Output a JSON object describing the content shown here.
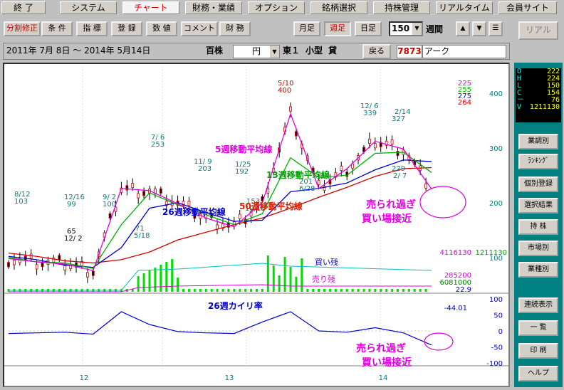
{
  "menu_tabs": [
    {
      "label": "終 了",
      "active": false
    },
    {
      "label": "システム",
      "active": false
    },
    {
      "label": "チャート",
      "active": true
    },
    {
      "label": "財務・業績",
      "active": false
    },
    {
      "label": "オプション",
      "active": false
    },
    {
      "label": "銘柄選択",
      "active": false
    },
    {
      "label": "持株管理",
      "active": false
    },
    {
      "label": "リアルタイム",
      "active": false
    },
    {
      "label": "会員サイト",
      "active": false
    }
  ],
  "toolbar": {
    "left_buttons": [
      "分割修正",
      "条 件",
      "指 標",
      "登 録",
      "数 値",
      "コメント",
      "財 務"
    ],
    "period_buttons": [
      "月足",
      "週足",
      "日足"
    ],
    "period_active": "週足",
    "count_value": "150",
    "count_unit": "週間",
    "nav_up": "▲",
    "nav_down": "▼",
    "nav_menu": "☰",
    "realtime_button": "リアル"
  },
  "info_bar": {
    "date_range": "2011年 7月 8日 ～ 2014年 5月14日",
    "unit": "百株",
    "currency": "円",
    "market": "東１",
    "size": "小型",
    "lending": "貸",
    "back_button": "戻る",
    "code": "7873",
    "name": "アーク"
  },
  "ohlc": {
    "rows": [
      {
        "k": "O",
        "v": "222"
      },
      {
        "k": "H",
        "v": "224"
      },
      {
        "k": "L",
        "v": "150"
      },
      {
        "k": "C",
        "v": "154"
      },
      {
        "k": "－",
        "v": "76"
      },
      {
        "k": "V",
        "v": "1211130"
      }
    ]
  },
  "side_buttons": [
    "業調別",
    "ﾗﾝｷﾝｸﾞ",
    "個別登録",
    "選択結果",
    "持 株",
    "市場別",
    "業種別",
    "連続表示",
    "一 覧",
    "印 刷",
    "ヘルプ"
  ],
  "chart_data": {
    "type": "line",
    "price_axis": {
      "ticks": [
        400,
        300,
        200,
        100
      ]
    },
    "top_legend": [
      {
        "v": "225",
        "color": "#e000e0"
      },
      {
        "v": "255",
        "color": "#00c000"
      },
      {
        "v": "275",
        "color": "#0000d0"
      },
      {
        "v": "264",
        "color": "#d00000"
      }
    ],
    "volume_labels": {
      "left": "4116130",
      "right": "1211130",
      "v1": "285200",
      "v2": "6081000",
      "v3": "22.9"
    },
    "kairi_axis": {
      "ticks": [
        "100",
        "50",
        "0",
        "-50",
        "-100"
      ],
      "current": "-44.01"
    },
    "x_labels": [
      "12",
      "13",
      "14"
    ],
    "price_annotations": [
      {
        "t": "8/12",
        "c": "#008080"
      },
      {
        "t": "103",
        "c": "#008080"
      },
      {
        "t": "12/16",
        "c": "#008080"
      },
      {
        "t": "99",
        "c": "#008080"
      },
      {
        "t": "9/ 2",
        "c": "#008080"
      },
      {
        "t": "100",
        "c": "#008080"
      },
      {
        "t": "65",
        "c": "#000"
      },
      {
        "t": "12/ 2",
        "c": "#000"
      },
      {
        "t": "71",
        "c": "#008080"
      },
      {
        "t": "5/18",
        "c": "#008080"
      },
      {
        "t": "7/ 6",
        "c": "#008080"
      },
      {
        "t": "253",
        "c": "#008080"
      },
      {
        "t": "11/ 9",
        "c": "#008080"
      },
      {
        "t": "203",
        "c": "#008080"
      },
      {
        "t": "1/25",
        "c": "#008080"
      },
      {
        "t": "192",
        "c": "#008080"
      },
      {
        "t": "5/10",
        "c": "#d00000"
      },
      {
        "t": "400",
        "c": "#d00000"
      },
      {
        "t": "12/ 6",
        "c": "#008080"
      },
      {
        "t": "339",
        "c": "#008080"
      },
      {
        "t": "2/14",
        "c": "#008080"
      },
      {
        "t": "327",
        "c": "#008080"
      },
      {
        "t": "229",
        "c": "#008080"
      },
      {
        "t": "2/ 7",
        "c": "#008080"
      },
      {
        "t": "201",
        "c": "#008080"
      },
      {
        "t": "6/28",
        "c": "#008080"
      },
      {
        "t": "153",
        "c": "#008080"
      },
      {
        "t": "10/18",
        "c": "#008080"
      }
    ],
    "ma_labels": [
      {
        "t": "5週移動平均線",
        "c": "#e000e0"
      },
      {
        "t": "13週移動平均線",
        "c": "#00a000"
      },
      {
        "t": "26週移動平均線",
        "c": "#0000d0"
      },
      {
        "t": "50週移動平均線",
        "c": "#e02000"
      }
    ],
    "vol_text": {
      "buy": "買い残",
      "sell": "売り残"
    },
    "kairi_title": "26週カイリ率",
    "callout": {
      "l1": "売られ過ぎ",
      "l2": "買い場接近"
    },
    "series": [
      {
        "name": "50週移動平均線",
        "color": "#d00000",
        "x": [
          0,
          10,
          20,
          30,
          40,
          50,
          60,
          70,
          80,
          90,
          100,
          110,
          120,
          130,
          140,
          150
        ],
        "y": [
          108,
          102,
          94,
          90,
          96,
          110,
          132,
          146,
          160,
          172,
          190,
          210,
          228,
          248,
          262,
          264
        ]
      },
      {
        "name": "26週移動平均線",
        "color": "#0000d0",
        "x": [
          0,
          10,
          20,
          30,
          40,
          50,
          60,
          70,
          80,
          90,
          100,
          110,
          120,
          130,
          140,
          150
        ],
        "y": [
          102,
          96,
          86,
          82,
          118,
          190,
          200,
          182,
          166,
          168,
          220,
          226,
          236,
          260,
          278,
          275
        ]
      },
      {
        "name": "13週移動平均線",
        "color": "#00b000",
        "x": [
          0,
          10,
          20,
          30,
          40,
          50,
          60,
          70,
          80,
          90,
          100,
          110,
          120,
          130,
          140,
          150
        ],
        "y": [
          100,
          92,
          90,
          80,
          160,
          218,
          196,
          178,
          160,
          180,
          282,
          246,
          250,
          290,
          292,
          255
        ]
      },
      {
        "name": "5週移動平均線",
        "color": "#e000e0",
        "x": [
          0,
          10,
          20,
          30,
          40,
          50,
          60,
          70,
          80,
          90,
          100,
          110,
          120,
          130,
          140,
          150
        ],
        "y": [
          98,
          92,
          88,
          76,
          226,
          222,
          198,
          172,
          156,
          200,
          362,
          226,
          262,
          312,
          298,
          225
        ]
      },
      {
        "name": "26週カイリ率",
        "color": "#0000d0",
        "x": [
          0,
          10,
          20,
          30,
          40,
          50,
          60,
          70,
          80,
          90,
          100,
          110,
          120,
          130,
          140,
          150
        ],
        "y": [
          -8,
          -6,
          -4,
          -10,
          60,
          20,
          -2,
          -6,
          -8,
          28,
          60,
          0,
          -4,
          10,
          -6,
          -44
        ]
      }
    ]
  }
}
